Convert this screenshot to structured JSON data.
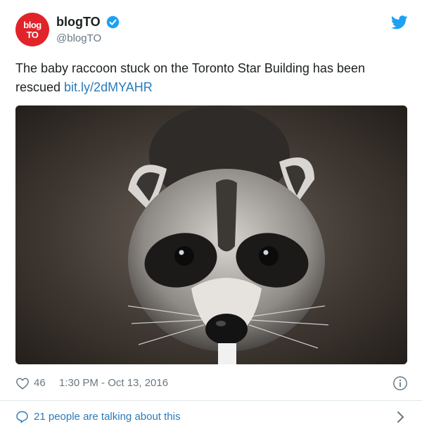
{
  "account": {
    "avatar_line1": "blog",
    "avatar_line2": "TO",
    "display_name": "blogTO",
    "handle": "@blogTO"
  },
  "tweet": {
    "text": "The baby raccoon stuck on the Toronto Star Building has been rescued ",
    "link": "bit.ly/2dMYAHR"
  },
  "meta": {
    "likes": "46",
    "timestamp": "1:30 PM - Oct 13, 2016"
  },
  "footer": {
    "talking": "21 people are talking about this"
  },
  "colors": {
    "brand": "#e0242a",
    "link": "#2b7bb9",
    "twitter": "#1da1f2"
  }
}
